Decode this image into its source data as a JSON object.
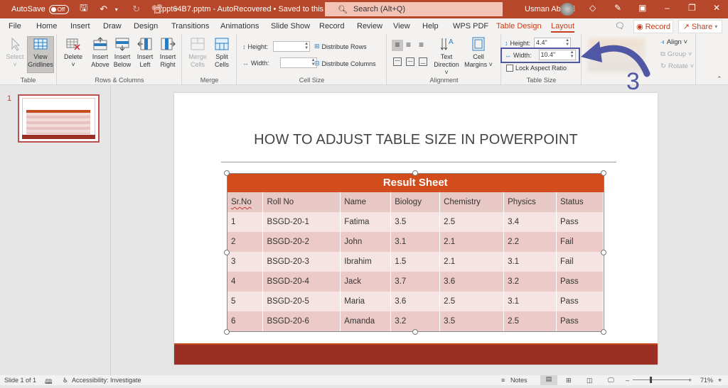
{
  "titlebar": {
    "autosave_label": "AutoSave",
    "autosave_state": "Off",
    "doc_title": "ppt64B7.pptm  -  AutoRecovered • Saved to this PC",
    "search_placeholder": "Search (Alt+Q)",
    "user_name": "Usman Abbasi",
    "icons": [
      "save-icon",
      "undo-icon",
      "redo-icon",
      "present-icon",
      "customize-icon",
      "diamond-icon",
      "pen-icon",
      "ribbon-display-icon",
      "minimize-icon",
      "restore-icon",
      "close-icon"
    ]
  },
  "menu": {
    "tabs": [
      "File",
      "Home",
      "Insert",
      "Draw",
      "Design",
      "Transitions",
      "Animations",
      "Slide Show",
      "Record",
      "Review",
      "View",
      "Help",
      "WPS PDF",
      "Table Design",
      "Layout"
    ],
    "active_tab": "Layout",
    "record_label": "Record",
    "share_label": "Share"
  },
  "ribbon": {
    "table_group": {
      "label": "Table",
      "select": "Select",
      "view_gridlines_1": "View",
      "view_gridlines_2": "Gridlines"
    },
    "rows_cols_group": {
      "label": "Rows & Columns",
      "delete": "Delete",
      "insert_above_1": "Insert",
      "insert_above_2": "Above",
      "insert_below_1": "Insert",
      "insert_below_2": "Below",
      "insert_left_1": "Insert",
      "insert_left_2": "Left",
      "insert_right_1": "Insert",
      "insert_right_2": "Right"
    },
    "merge_group": {
      "label": "Merge",
      "merge_1": "Merge",
      "merge_2": "Cells",
      "split_1": "Split",
      "split_2": "Cells"
    },
    "cell_size_group": {
      "label": "Cell Size",
      "height_label": "Height:",
      "height_value": "",
      "width_label": "Width:",
      "width_value": "",
      "distribute_rows": "Distribute Rows",
      "distribute_columns": "Distribute Columns"
    },
    "alignment_group": {
      "label": "Alignment",
      "text_direction_1": "Text",
      "text_direction_2": "Direction ˅",
      "cell_margins_1": "Cell",
      "cell_margins_2": "Margins ˅"
    },
    "table_size_group": {
      "label": "Table Size",
      "height_label": "Height:",
      "height_value": "4.4\"",
      "width_label": "Width:",
      "width_value": "10.4\"",
      "lock_aspect": "Lock Aspect Ratio"
    },
    "arrange_group": {
      "align": "Align ˅",
      "group": "Group ˅",
      "rotate": "Rotate ˅"
    }
  },
  "annotation": {
    "step_number": "3",
    "color": "#5057a4"
  },
  "slides_panel": {
    "slide_number": "1"
  },
  "slide": {
    "title": "HOW TO ADJUST TABLE SIZE IN POWERPOINT",
    "table": {
      "caption": "Result  Sheet",
      "headers": [
        "Sr.No",
        "Roll No",
        "Name",
        "Biology",
        "Chemistry",
        "Physics",
        "Status"
      ],
      "rows": [
        [
          "1",
          "BSGD-20-1",
          "Fatima",
          "3.5",
          "2.5",
          "3.4",
          "Pass"
        ],
        [
          "2",
          "BSGD-20-2",
          "John",
          "3.1",
          "2.1",
          "2.2",
          "Fail"
        ],
        [
          "3",
          "BSGD-20-3",
          "Ibrahim",
          "1.5",
          "2.1",
          "3.1",
          "Fail"
        ],
        [
          "4",
          "BSGD-20-4",
          "Jack",
          "3.7",
          "3.6",
          "3.2",
          "Pass"
        ],
        [
          "5",
          "BSGD-20-5",
          "Maria",
          "3.6",
          "2.5",
          "3.1",
          "Pass"
        ],
        [
          "6",
          "BSGD-20-6",
          "Amanda",
          "3.2",
          "3.5",
          "2.5",
          "Pass"
        ]
      ]
    },
    "colors": {
      "header": "#d34c1c",
      "footer": "#9c2f23"
    }
  },
  "statusbar": {
    "slide_info": "Slide 1 of 1",
    "accessibility": "Accessibility: Investigate",
    "notes": "Notes",
    "zoom": "71%"
  }
}
